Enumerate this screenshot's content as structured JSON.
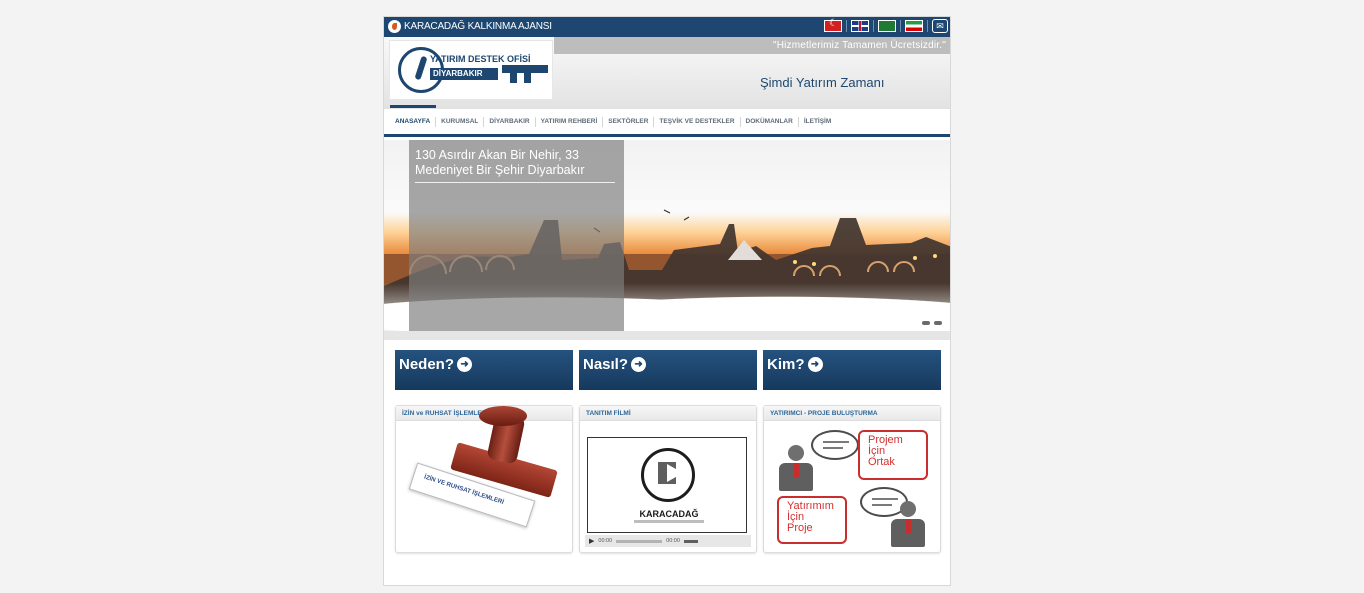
{
  "topbar": {
    "org_name": "KARACADAĞ KALKINMA AJANSI",
    "languages": [
      "tr-flag-icon",
      "en-flag-icon",
      "ar-flag-icon",
      "fa-flag-icon",
      "mail-icon"
    ]
  },
  "header": {
    "logo_line1": "YATIRIM DESTEK OFİSİ",
    "logo_line2": "DİYARBAKIR",
    "slogan": "\"Hizmetlerimiz Tamamen Ücretsizdir.\"",
    "tagline": "Şimdi Yatırım Zamanı"
  },
  "nav": {
    "items": [
      {
        "label": "ANASAYFA"
      },
      {
        "label": "KURUMSAL"
      },
      {
        "label": "DİYARBAKIR"
      },
      {
        "label": "YATIRIM REHBERİ"
      },
      {
        "label": "SEKTÖRLER"
      },
      {
        "label": "TEŞVİK VE DESTEKLER"
      },
      {
        "label": "DOKÜMANLAR"
      },
      {
        "label": "İLETİŞİM"
      }
    ]
  },
  "banner": {
    "caption": "130 Asırdır Akan Bir Nehir, 33 Medeniyet Bir Şehir Diyarbakır"
  },
  "promo": {
    "neden": "Neden?",
    "nasil": "Nasıl?",
    "kim": "Kim?"
  },
  "cards": {
    "izin": {
      "title": "İZİN ve RUHSAT İŞLEMLERİ",
      "stamp_text": "İZİN VE RUHSAT İŞLEMLERİ"
    },
    "film": {
      "title": "TANITIM FİLMİ",
      "video_title": "KARACADAĞ",
      "time_current": "00:00",
      "time_total": "00:00"
    },
    "yatirimci": {
      "title": "YATIRIMCI - PROJE BULUŞTURMA",
      "box1": [
        "Projem",
        "İçin",
        "Ortak"
      ],
      "box2": [
        "Yatırımım",
        "İçin",
        "Proje"
      ]
    }
  }
}
